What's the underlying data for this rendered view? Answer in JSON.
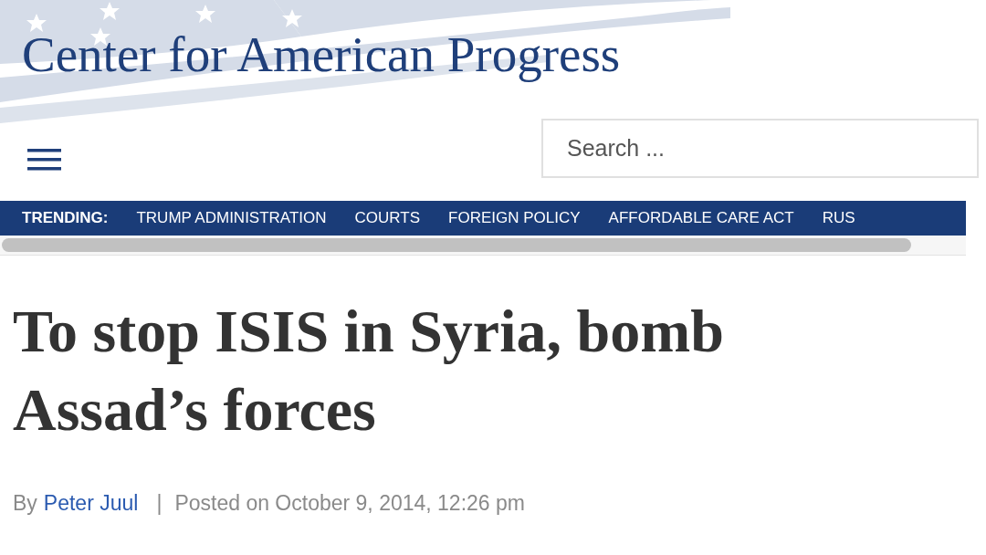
{
  "header": {
    "logo": "Center for American Progress"
  },
  "search": {
    "placeholder": "Search ..."
  },
  "trending": {
    "label": "TRENDING:",
    "items": [
      "TRUMP ADMINISTRATION",
      "COURTS",
      "FOREIGN POLICY",
      "AFFORDABLE CARE ACT",
      "RUS"
    ]
  },
  "article": {
    "headline": "To stop ISIS in Syria, bomb Assad’s forces",
    "byline_prefix": "By",
    "author": "Peter Juul",
    "separator": "|",
    "posted": "Posted on October 9, 2014, 12:26 pm"
  }
}
